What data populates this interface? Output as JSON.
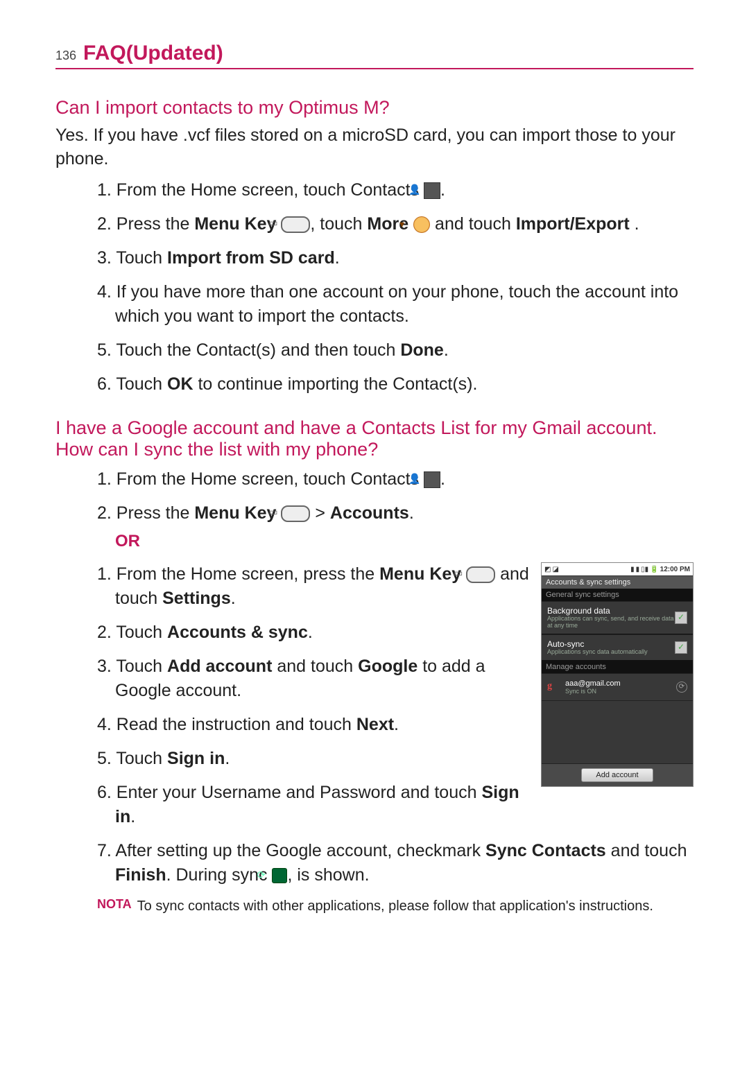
{
  "header": {
    "page_number": "136",
    "title": "FAQ(Updated)"
  },
  "q1": {
    "heading": "Can I import contacts to my Optimus M?",
    "intro": "Yes. If you have .vcf files stored on a microSD card, you can import those to your phone.",
    "steps": {
      "s1_a": "From the Home screen, touch Contacts ",
      "s1_b": ".",
      "s2_a": "Press the ",
      "s2_menu": "Menu Key",
      "s2_b": ", touch ",
      "s2_more": "More",
      "s2_c": " and touch ",
      "s2_ie": "Import/Export",
      "s2_d": " .",
      "s3_a": "Touch ",
      "s3_b": "Import from SD card",
      "s3_c": ".",
      "s4": "If you have more than one account on your phone, touch the account into which you want to import the contacts.",
      "s5_a": "Touch the Contact(s) and then touch ",
      "s5_b": "Done",
      "s5_c": ".",
      "s6_a": "Touch ",
      "s6_b": "OK",
      "s6_c": " to continue importing the Contact(s)."
    }
  },
  "q2": {
    "heading": "I have a Google account and have a Contacts List for my Gmail account. How can I sync the list with my phone?",
    "stepsA": {
      "s1_a": "From the Home screen, touch Contacts ",
      "s1_b": ".",
      "s2_a": "Press the ",
      "s2_menu": "Menu Key",
      "s2_b": " > ",
      "s2_acc": "Accounts",
      "s2_c": "."
    },
    "or": "OR",
    "stepsB": {
      "s1_a": "From the Home screen, press the ",
      "s1_menu": "Menu Key",
      "s1_b": " and touch ",
      "s1_set": "Settings",
      "s1_c": ".",
      "s2_a": "Touch ",
      "s2_b": "Accounts & sync",
      "s2_c": ".",
      "s3_a": "Touch ",
      "s3_b": "Add account",
      "s3_c": " and touch ",
      "s3_d": "Google",
      "s3_e": " to add a Google account.",
      "s4_a": "Read the instruction and touch ",
      "s4_b": "Next",
      "s4_c": ".",
      "s5_a": "Touch ",
      "s5_b": "Sign in",
      "s5_c": ".",
      "s6_a": "Enter your Username and Password and touch ",
      "s6_b": "Sign in",
      "s6_c": ".",
      "s7_a": "After setting up the Google account, checkmark ",
      "s7_b": "Sync Contacts",
      "s7_c": " and touch ",
      "s7_d": "Finish",
      "s7_e": ". During sync ",
      "s7_f": ", is shown."
    },
    "note_label": "NOTA",
    "note_text": "To sync contacts with other applications, please follow that application's instructions."
  },
  "mock": {
    "time": "12:00 PM",
    "title": "Accounts & sync settings",
    "section1": "General sync settings",
    "item1_title": "Background data",
    "item1_sub": "Applications can sync, send, and receive data at any time",
    "item2_title": "Auto-sync",
    "item2_sub": "Applications sync data automatically",
    "section2": "Manage accounts",
    "account_email": "aaa@gmail.com",
    "account_sub": "Sync is ON",
    "button": "Add account"
  }
}
